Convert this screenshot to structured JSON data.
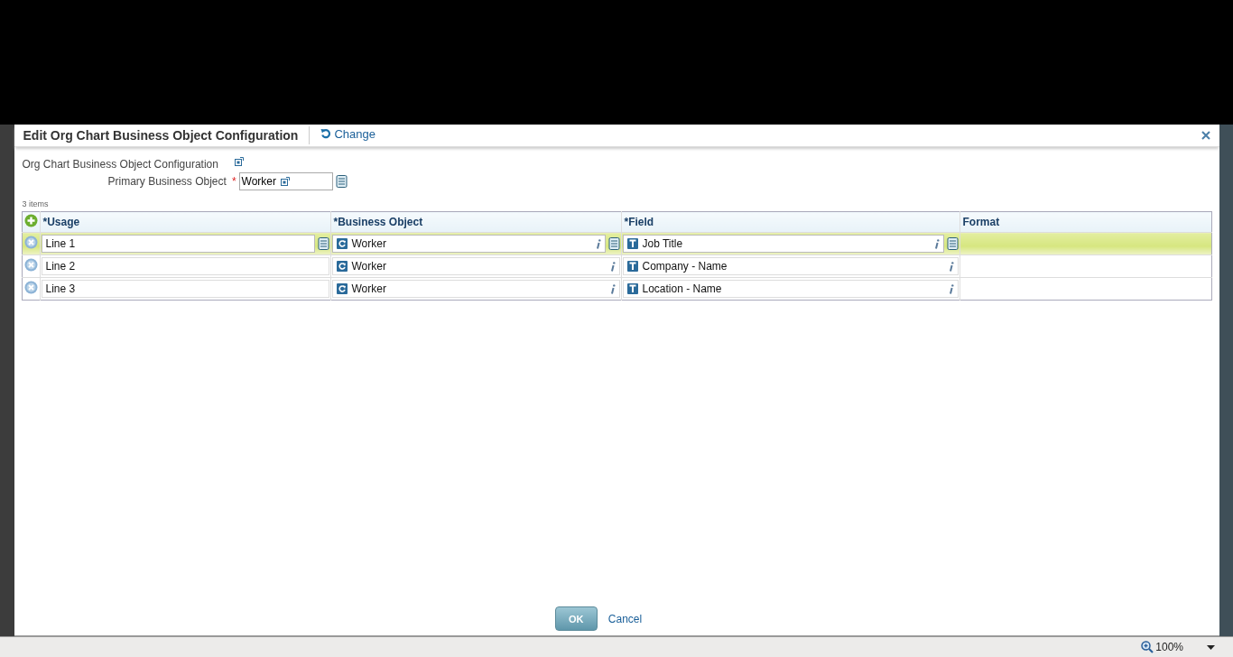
{
  "dialog": {
    "title": "Edit Org Chart Business Object Configuration",
    "change_link": "Change"
  },
  "form": {
    "config_label": "Org Chart Business Object Configuration",
    "primary_label": "Primary Business Object",
    "required_mark": "*",
    "primary_value": "Worker"
  },
  "table": {
    "count": "3 items",
    "columns": [
      "*Usage",
      "*Business Object",
      "*Field",
      "Format"
    ],
    "rows": [
      {
        "usage": "Line 1",
        "business_object": "Worker",
        "field": "Job Title",
        "selected": true
      },
      {
        "usage": "Line 2",
        "business_object": "Worker",
        "field": "Company - Name",
        "selected": false
      },
      {
        "usage": "Line 3",
        "business_object": "Worker",
        "field": "Location - Name",
        "selected": false
      }
    ]
  },
  "buttons": {
    "ok": "OK",
    "cancel": "Cancel"
  },
  "status_bar": {
    "zoom": "100%"
  }
}
